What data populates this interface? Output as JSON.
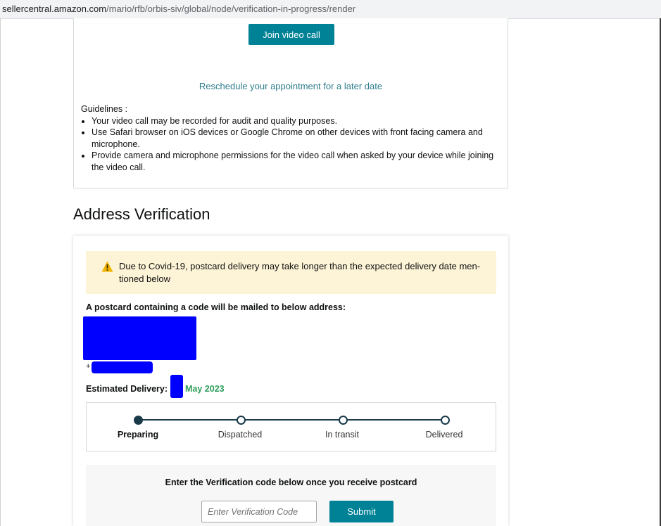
{
  "browser": {
    "url_host": "sellercentral.amazon.com",
    "url_path": "/mario/rfb/orbis-siv/global/node/verification-in-progress/render"
  },
  "video_call": {
    "join_label": "Join video call",
    "reschedule_label": "Reschedule your appointment for a later date",
    "guidelines_title": "Guidelines :",
    "guidelines": [
      "Your video call may be recorded for audit and quality purposes.",
      "Use Safari browser on iOS devices or Google Chrome on other devices with front facing camera and microphone.",
      "Provide camera and microphone permissions for the video call when asked by your device while joining the video call."
    ]
  },
  "address_verification": {
    "title": "Address Verification",
    "alert_text": "Due to Covid-19, postcard delivery may take longer than the expected delivery date men-tioned below",
    "mail_label": "A postcard containing a code will be mailed to below address:",
    "phone_prefix": "+",
    "estimated_label": "Estimated Delivery:",
    "estimated_date": "May 2023",
    "steps": [
      "Preparing",
      "Dispatched",
      "In transit",
      "Delivered"
    ],
    "active_step": 0,
    "code_prompt": "Enter the Verification code below once you receive postcard",
    "code_placeholder": "Enter Verification Code",
    "code_value": "",
    "submit_label": "Submit"
  },
  "colors": {
    "accent": "#008296",
    "link": "#2e7d8c",
    "alert_bg": "#fdf3d6",
    "warning_icon": "#f0b400",
    "date_green": "#2e9e5b",
    "redaction": "#0000ff"
  }
}
